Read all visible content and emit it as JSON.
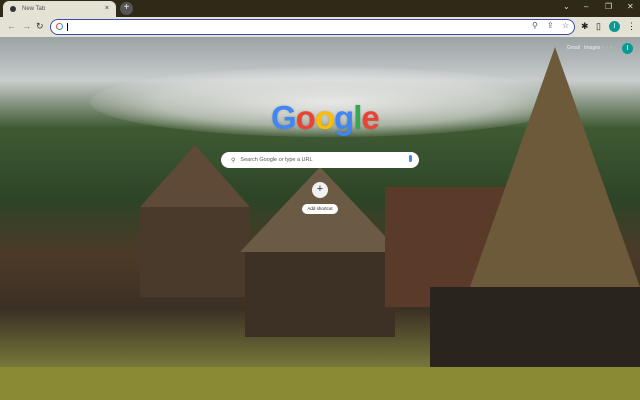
{
  "tab": {
    "title": "New Tab",
    "close": "×",
    "new_tab": "+"
  },
  "window": {
    "dropdown": "⌄",
    "minimize": "–",
    "restore": "❐",
    "close": "✕"
  },
  "toolbar": {
    "back": "←",
    "forward": "→",
    "reload": "↻",
    "omnibox_value": "",
    "zoom_icon": "⚲",
    "share_icon": "⇪",
    "star_icon": "☆",
    "extensions_icon": "✱",
    "sidepanel_icon": "▯",
    "profile_initial": "I",
    "menu_icon": "⋮"
  },
  "ntp": {
    "gmail": "Gmail",
    "images": "Images",
    "apps_icon": "⋮⋮⋮",
    "profile_initial": "I",
    "logo": [
      "G",
      "o",
      "o",
      "g",
      "l",
      "e"
    ],
    "logo_colors": [
      "#4285f4",
      "#ea4335",
      "#fbbc05",
      "#4285f4",
      "#34a853",
      "#ea4335"
    ],
    "search_placeholder": "Search Google or type a URL",
    "add_shortcut_icon": "+",
    "add_shortcut_label": "Add shortcut"
  }
}
